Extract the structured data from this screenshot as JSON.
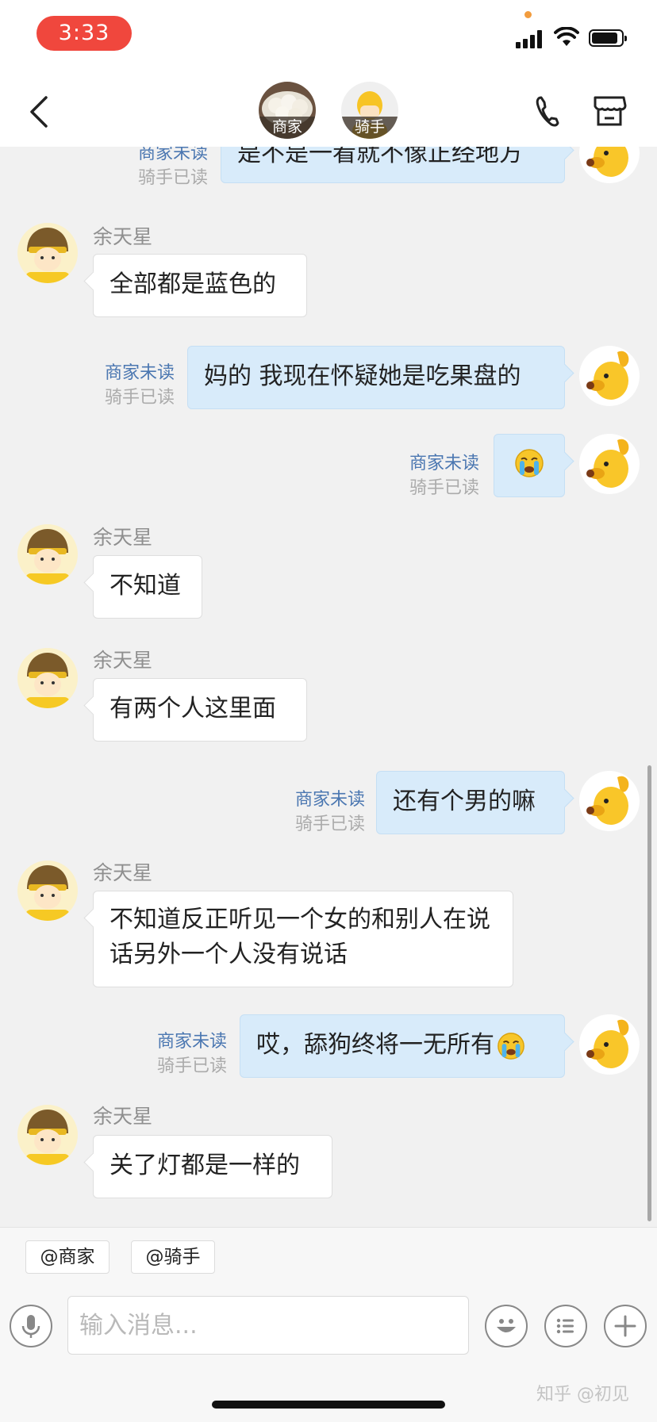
{
  "status_bar": {
    "time": "3:33"
  },
  "header": {
    "merchant_label": "商家",
    "rider_label": "骑手"
  },
  "status_labels": {
    "unread": "商家未读",
    "read": "骑手已读"
  },
  "messages": [
    {
      "side": "out",
      "text": "是不是一看就不像正经地方",
      "unread": "商家未读",
      "read": "骑手已读"
    },
    {
      "side": "in",
      "sender": "余天星",
      "text": "全部都是蓝色的"
    },
    {
      "side": "out",
      "text": "妈的 我现在怀疑她是吃果盘的",
      "unread": "商家未读",
      "read": "骑手已读"
    },
    {
      "side": "out",
      "emoji": "crying-face",
      "unread": "商家未读",
      "read": "骑手已读"
    },
    {
      "side": "in",
      "sender": "余天星",
      "text": "不知道"
    },
    {
      "side": "in",
      "sender": "余天星",
      "text": "有两个人这里面"
    },
    {
      "side": "out",
      "text": "还有个男的嘛",
      "unread": "商家未读",
      "read": "骑手已读"
    },
    {
      "side": "in",
      "sender": "余天星",
      "text": "不知道反正听见一个女的和别人在说话另外一个人没有说话"
    },
    {
      "side": "out",
      "text": "哎，舔狗终将一无所有",
      "emoji": "crying-face",
      "unread": "商家未读",
      "read": "骑手已读"
    },
    {
      "side": "in",
      "sender": "余天星",
      "text": "关了灯都是一样的"
    }
  ],
  "composer": {
    "mention_merchant": "@商家",
    "mention_rider": "@骑手",
    "placeholder": "输入消息..."
  },
  "watermark": "知乎 @初见",
  "colors": {
    "time_pill": "#f0473d",
    "out_bubble": "#d8ebfa",
    "unread_text": "#4b77b1",
    "read_text": "#ababab"
  }
}
